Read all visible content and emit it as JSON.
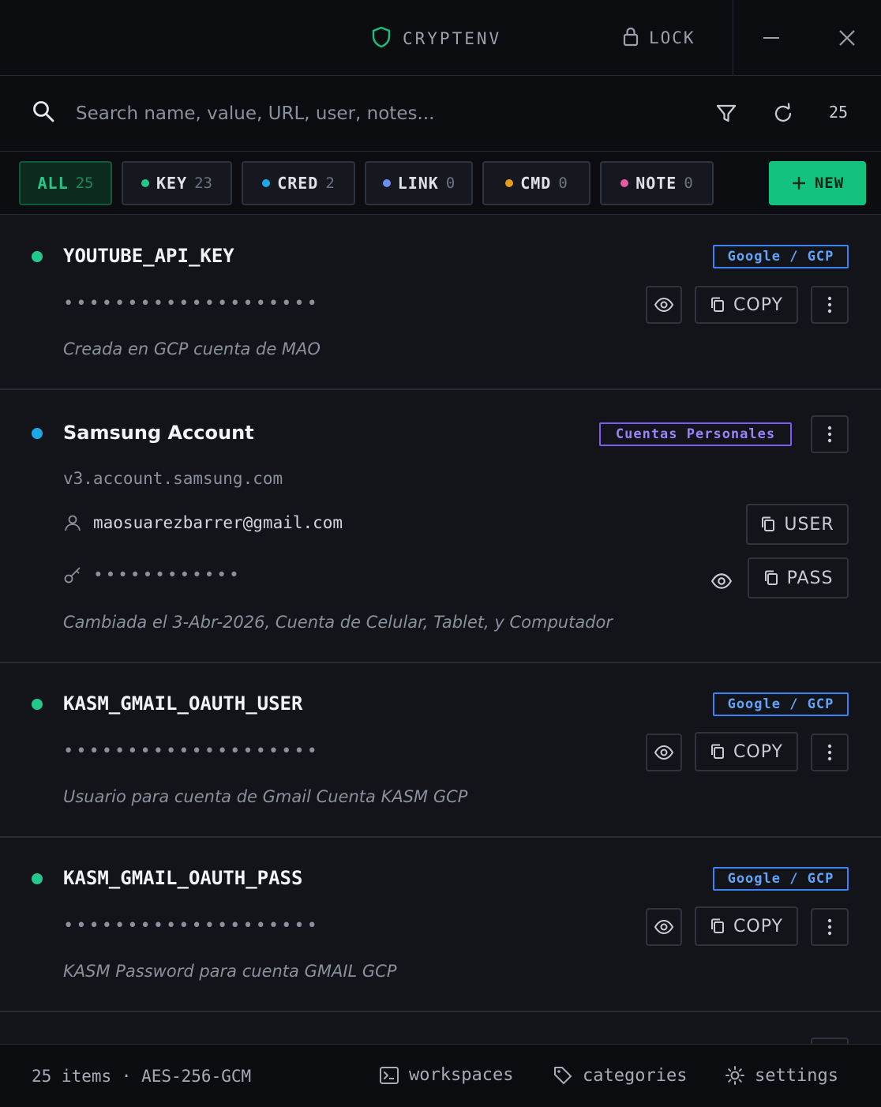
{
  "app": {
    "title": "CRYPTENV",
    "lock_label": "LOCK",
    "accent": "#12c27e"
  },
  "search": {
    "placeholder": "Search name, value, URL, user, notes...",
    "value": "",
    "count": "25"
  },
  "tabs": [
    {
      "label": "ALL",
      "count": "25",
      "color": "",
      "active": true
    },
    {
      "label": "KEY",
      "count": "23",
      "color": "#22c98a"
    },
    {
      "label": "CRED",
      "count": "2",
      "color": "#1aa9e6"
    },
    {
      "label": "LINK",
      "count": "0",
      "color": "#6b8ff2"
    },
    {
      "label": "CMD",
      "count": "0",
      "color": "#e39b18"
    },
    {
      "label": "NOTE",
      "count": "0",
      "color": "#ea5aa0"
    }
  ],
  "new_button": {
    "label": "NEW"
  },
  "entries": [
    {
      "name": "YOUTUBE_API_KEY",
      "type_color": "#22c98a",
      "category": "Google / GCP",
      "masked_value": "••••••••••••••••••••",
      "copy_label": "COPY",
      "note": "Creada en GCP cuenta de MAO"
    },
    {
      "name": "Samsung Account",
      "type_color": "#1aa9e6",
      "category": "Cuentas Personales",
      "url": "v3.account.samsung.com",
      "user": "maosuarezbarrer@gmail.com",
      "masked_password": "••••••••••••",
      "user_button": "USER",
      "pass_button": "PASS",
      "note": "Cambiada el 3-Abr-2026, Cuenta de Celular, Tablet, y Computador"
    },
    {
      "name": "KASM_GMAIL_OAUTH_USER",
      "type_color": "#22c98a",
      "category": "Google / GCP",
      "masked_value": "••••••••••••••••••••",
      "copy_label": "COPY",
      "note": "Usuario para cuenta de Gmail Cuenta KASM GCP"
    },
    {
      "name": "KASM_GMAIL_OAUTH_PASS",
      "type_color": "#22c98a",
      "category": "Google / GCP",
      "masked_value": "••••••••••••••••••••",
      "copy_label": "COPY",
      "note": "KASM Password para cuenta GMAIL GCP"
    }
  ],
  "footer": {
    "status": "25 items · AES-256-GCM",
    "workspaces": "workspaces",
    "categories": "categories",
    "settings": "settings"
  }
}
